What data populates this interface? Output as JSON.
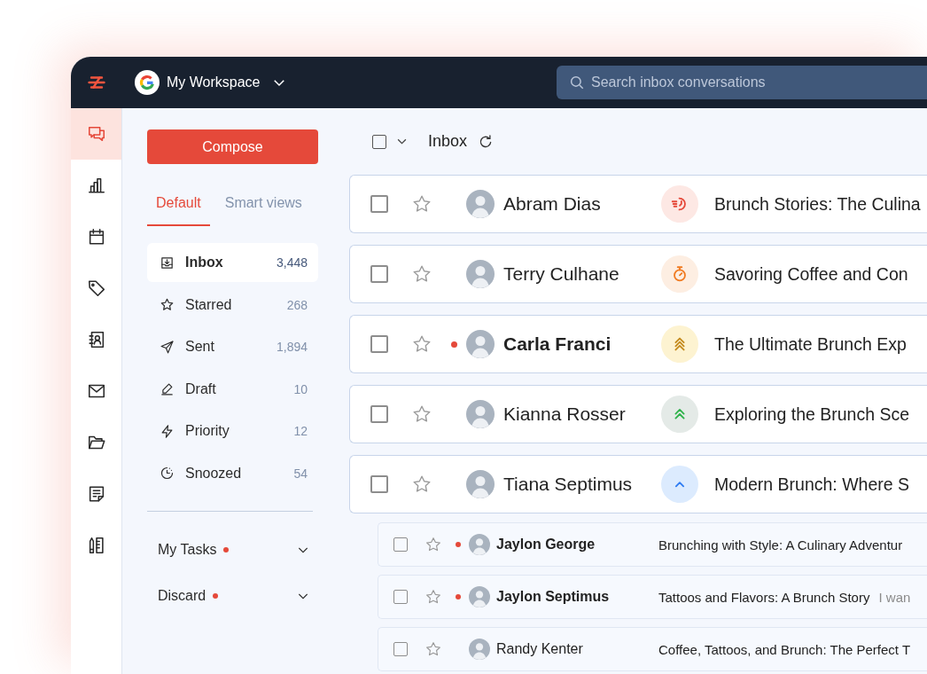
{
  "topbar": {
    "workspace": "My Workspace",
    "search": {
      "placeholder": "Search inbox conversations"
    }
  },
  "rail": [
    {
      "kind": "chats",
      "selected": true
    },
    {
      "kind": "reports",
      "selected": false
    },
    {
      "kind": "calendar",
      "selected": false
    },
    {
      "kind": "tags",
      "selected": false
    },
    {
      "kind": "contacts",
      "selected": false
    },
    {
      "kind": "mail",
      "selected": false
    },
    {
      "kind": "folders",
      "selected": false
    },
    {
      "kind": "notes",
      "selected": false
    },
    {
      "kind": "tools",
      "selected": false
    }
  ],
  "sidebar": {
    "compose": "Compose",
    "tabs": [
      {
        "label": "Default",
        "selected": true
      },
      {
        "label": "Smart views",
        "selected": false
      }
    ],
    "folders": [
      {
        "kind": "inbox",
        "label": "Inbox",
        "count": "3,448",
        "selected": true
      },
      {
        "kind": "starred",
        "label": "Starred",
        "count": "268",
        "selected": false
      },
      {
        "kind": "sent",
        "label": "Sent",
        "count": "1,894",
        "selected": false
      },
      {
        "kind": "draft",
        "label": "Draft",
        "count": "10",
        "selected": false
      },
      {
        "kind": "priority",
        "label": "Priority",
        "count": "12",
        "selected": false
      },
      {
        "kind": "snoozed",
        "label": "Snoozed",
        "count": "54",
        "selected": false
      }
    ],
    "sections": [
      {
        "label": "My Tasks",
        "alert": true,
        "expanded": false
      },
      {
        "label": "Discard",
        "alert": true,
        "expanded": false
      }
    ]
  },
  "toolbar": {
    "checked": false,
    "title": "Inbox"
  },
  "rows": [
    {
      "name": "Abram Dias",
      "subject": "Brunch Stories: The Culina",
      "unread": false,
      "checked": false,
      "starred": false,
      "badge": {
        "kind": "overdue"
      }
    },
    {
      "name": "Terry Culhane",
      "subject": "Savoring Coffee and Con",
      "unread": false,
      "checked": false,
      "starred": false,
      "badge": {
        "kind": "timer"
      }
    },
    {
      "name": "Carla Franci",
      "subject": "The Ultimate Brunch Exp",
      "unread": true,
      "checked": false,
      "starred": false,
      "badge": {
        "kind": "urgent"
      }
    },
    {
      "name": "Kianna Rosser",
      "subject": "Exploring the Brunch Sce",
      "unread": false,
      "checked": false,
      "starred": false,
      "badge": {
        "kind": "high"
      }
    },
    {
      "name": "Tiana Septimus",
      "subject": "Modern Brunch: Where S",
      "unread": false,
      "checked": false,
      "starred": false,
      "badge": {
        "kind": "normal"
      },
      "children": [
        {
          "name": "Jaylon George",
          "subject": "Brunching with Style: A Culinary Adventur",
          "unread": true,
          "checked": false,
          "starred": false
        },
        {
          "name": "Jaylon Septimus",
          "subject": "Tattoos and Flavors: A Brunch Story",
          "preview": "I wan",
          "unread": true,
          "checked": false,
          "starred": false
        },
        {
          "name": "Randy Kenter",
          "subject": "Coffee, Tattoos, and Brunch: The Perfect T",
          "unread": false,
          "checked": false,
          "starred": false
        }
      ]
    }
  ]
}
